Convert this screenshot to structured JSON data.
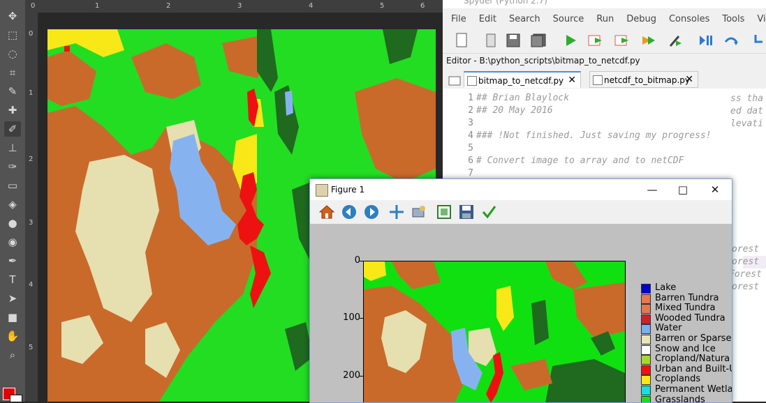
{
  "photoshop": {
    "ruler_top_numbers": [
      "0",
      "1",
      "2",
      "3",
      "4",
      "5",
      "6"
    ],
    "ruler_left_numbers": [
      "0",
      "1",
      "2",
      "3",
      "4",
      "5"
    ],
    "foreground_color": "#e30000",
    "background_color": "#ffffff",
    "tools": [
      "move-tool-icon",
      "marquee-tool-icon",
      "lasso-tool-icon",
      "crop-tool-icon",
      "eyedropper-tool-icon",
      "healing-tool-icon",
      "brush-tool-icon",
      "stamp-tool-icon",
      "history-brush-icon",
      "eraser-tool-icon",
      "paint-bucket-icon",
      "blur-tool-icon",
      "dodge-tool-icon",
      "pen-tool-icon",
      "type-tool-icon",
      "path-select-icon",
      "shape-tool-icon",
      "hand-tool-icon",
      "zoom-tool-icon"
    ]
  },
  "spyder": {
    "title": "Spyder (Python 2.7)",
    "menu": [
      "File",
      "Edit",
      "Search",
      "Source",
      "Run",
      "Debug",
      "Consoles",
      "Tools",
      "View",
      "Help"
    ],
    "editor_path": "Editor - B:\\python_scripts\\bitmap_to_netcdf.py",
    "tabs": [
      {
        "label": "bitmap_to_netcdf.py",
        "active": true
      },
      {
        "label": "netcdf_to_bitmap.py",
        "active": false
      }
    ],
    "code_lines": [
      {
        "num": "1",
        "text": "## Brian Blaylock"
      },
      {
        "num": "2",
        "text": "## 20 May 2016"
      },
      {
        "num": "3",
        "text": ""
      },
      {
        "num": "4",
        "text": "### !Not finished. Just saving my progress!"
      },
      {
        "num": "5",
        "text": ""
      },
      {
        "num": "6",
        "text": "# Convert image to array and to netCDF"
      },
      {
        "num": "7",
        "text": ""
      }
    ],
    "code_fragments_right": [
      "ss tha",
      "ed dat",
      "levati",
      "orest",
      "orest",
      "Forest",
      "orest"
    ]
  },
  "figure": {
    "title": "Figure 1",
    "toolbar": [
      "home-icon",
      "back-icon",
      "forward-icon",
      "pan-icon",
      "configure-subplots-icon",
      "zoom-rect-icon",
      "save-icon",
      "check-icon"
    ],
    "y_ticks": [
      "0",
      "100",
      "200"
    ],
    "legend": [
      {
        "label": "Lake",
        "color": "#0000d0"
      },
      {
        "label": "Barren Tundra",
        "color": "#e87850"
      },
      {
        "label": "Mixed Tundra",
        "color": "#e07a55"
      },
      {
        "label": "Wooded Tundra",
        "color": "#d0202a"
      },
      {
        "label": "Water",
        "color": "#7ab0f0"
      },
      {
        "label": "Barren or Sparse",
        "color": "#ece4b4"
      },
      {
        "label": "Snow and Ice",
        "color": "#ffffff"
      },
      {
        "label": "Cropland/Natura",
        "color": "#a8d830"
      },
      {
        "label": "Urban and Built-U",
        "color": "#ee1111"
      },
      {
        "label": "Croplands",
        "color": "#f8e818"
      },
      {
        "label": "Permanent Wetla",
        "color": "#18e0d8"
      },
      {
        "label": "Grasslands",
        "color": "#18e018"
      }
    ]
  }
}
